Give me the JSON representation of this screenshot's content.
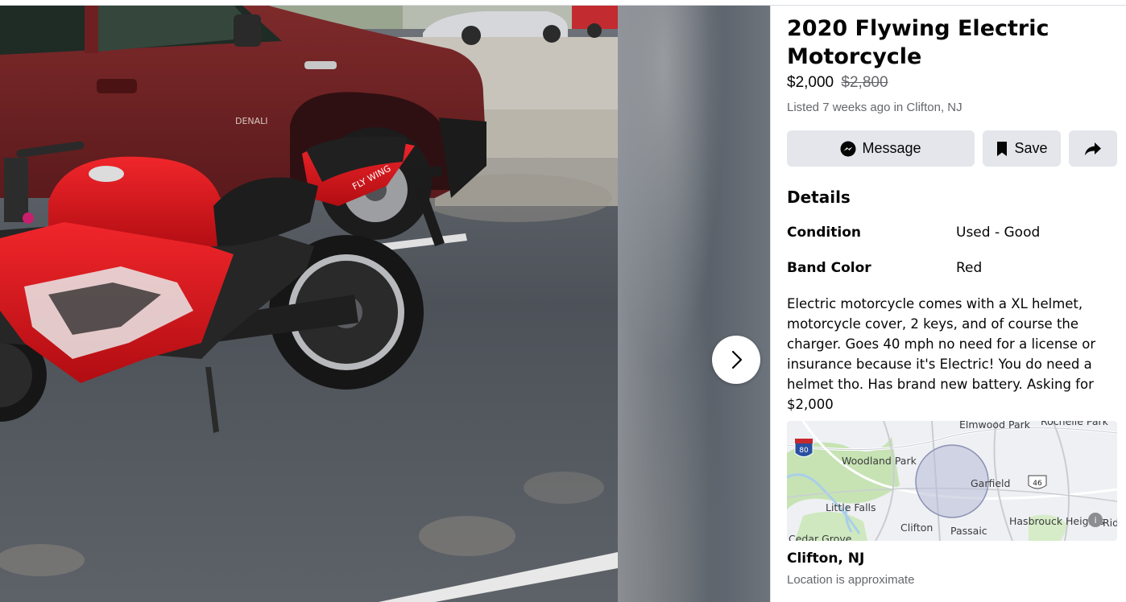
{
  "listing": {
    "title": "2020 Flywing Electric Motorcycle",
    "price": "$2,000",
    "original_price": "$2,800",
    "listed": "Listed 7 weeks ago in Clifton, NJ"
  },
  "actions": {
    "message_label": "Message",
    "save_label": "Save"
  },
  "details": {
    "heading": "Details",
    "rows": [
      {
        "label": "Condition",
        "value": "Used - Good"
      },
      {
        "label": "Band Color",
        "value": "Red"
      }
    ],
    "description": "Electric motorcycle comes with a XL helmet, motorcycle cover, 2 keys, and of course the charger. Goes 40 mph no need for a license or insurance because it's Electric! You do need a helmet tho.  Has brand new battery. Asking for $2,000"
  },
  "photo": {
    "vehicle_badge": "DENALI",
    "bike_decal": "FLY WING"
  },
  "map": {
    "labels": {
      "elmwood_park": "Elmwood Park",
      "rochelle_park": "Rochelle Park",
      "woodland_park": "Woodland Park",
      "garfield": "Garfield",
      "little_falls": "Little Falls",
      "clifton": "Clifton",
      "passaic": "Passaic",
      "hasbrouck_heights": "Hasbrouck Heights",
      "cedar_grove": "Cedar Grove",
      "rid": "Rid"
    },
    "shields": {
      "interstate": "80",
      "us_route": "46"
    },
    "info_icon": "i"
  },
  "location": {
    "name": "Clifton, NJ",
    "note": "Location is approximate"
  },
  "icons": {
    "message": "messenger-icon",
    "save": "bookmark-icon",
    "share": "share-arrow-icon",
    "next": "chevron-right-icon"
  }
}
